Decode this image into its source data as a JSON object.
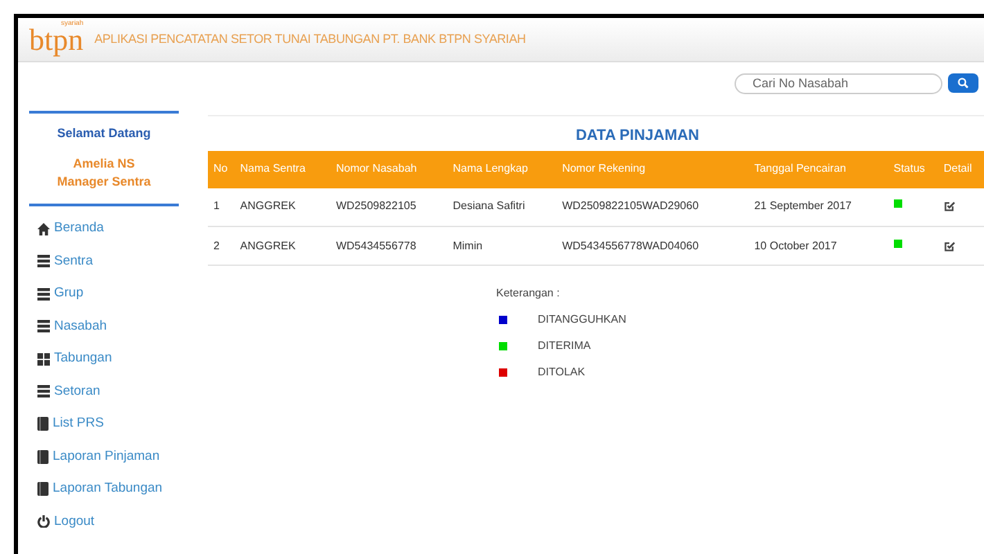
{
  "header": {
    "logo": "btpn",
    "logo_sub": "syariah",
    "title": "APLIKASI PENCATATAN SETOR TUNAI TABUNGAN PT. BANK BTPN SYARIAH"
  },
  "search": {
    "placeholder": "Cari No Nasabah"
  },
  "sidebar": {
    "greeting": "Selamat Datang",
    "user": "Amelia NS",
    "role": "Manager Sentra",
    "items": [
      {
        "label": "Beranda",
        "kind": "home"
      },
      {
        "label": "Sentra",
        "kind": "list"
      },
      {
        "label": "Grup",
        "kind": "list"
      },
      {
        "label": "Nasabah",
        "kind": "list"
      },
      {
        "label": "Tabungan",
        "kind": "grid"
      },
      {
        "label": "Setoran",
        "kind": "list"
      },
      {
        "label": "List PRS",
        "kind": "book"
      },
      {
        "label": "Laporan Pinjaman",
        "kind": "book"
      },
      {
        "label": "Laporan Tabungan",
        "kind": "book"
      },
      {
        "label": "Logout",
        "kind": "power"
      }
    ]
  },
  "table": {
    "title": "DATA PINJAMAN",
    "columns": [
      "No",
      "Nama Sentra",
      "Nomor Nasabah",
      "Nama Lengkap",
      "Nomor Rekening",
      "Tanggal Pencairan",
      "Status",
      "Detail"
    ],
    "rows": [
      {
        "cells": [
          "1",
          "ANGGREK",
          "WD2509822105",
          "Desiana Safitri",
          "WD2509822105WAD29060",
          "21 September 2017"
        ],
        "color": "#00dd00"
      },
      {
        "cells": [
          "2",
          "ANGGREK",
          "WD5434556778",
          "Mimin",
          "WD5434556778WAD04060",
          "10 October 2017"
        ],
        "color": "#00dd00"
      }
    ]
  },
  "legend": {
    "title": "Keterangan :",
    "items": [
      {
        "label": "DITANGGUHKAN",
        "color": "#0000cc"
      },
      {
        "label": "DITERIMA",
        "color": "#00dd00"
      },
      {
        "label": "DITOLAK",
        "color": "#dd0000"
      }
    ]
  }
}
